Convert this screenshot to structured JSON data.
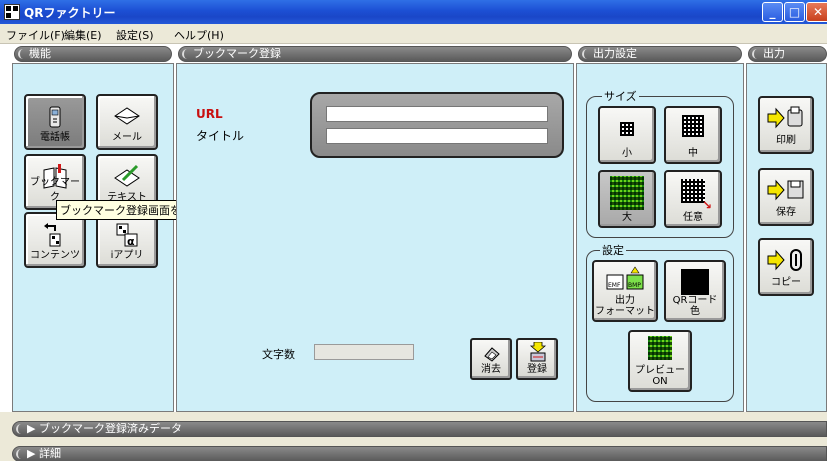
{
  "window": {
    "title": "QRファクトリー",
    "controls": [
      "minimize-icon",
      "maximize-icon",
      "close-icon"
    ]
  },
  "menu": [
    "ファイル(F)",
    "編集(E)",
    "設定(S)",
    "ヘルプ(H)"
  ],
  "panels": {
    "function": {
      "header": "機能",
      "buttons": [
        "電話帳",
        "メール",
        "ブックマーク",
        "テキスト",
        "コンテンツ",
        "iアプリ"
      ],
      "tooltip": "ブックマーク登録画面を表示します"
    },
    "bookmark": {
      "header": "ブックマーク登録",
      "url_label": "URL",
      "title_label": "タイトル",
      "url_value": "",
      "title_value": "",
      "char_count_label": "文字数",
      "char_count_value": "",
      "clear_label": "消去",
      "register_label": "登録"
    },
    "output_settings": {
      "header": "出力設定",
      "size_group": "サイズ",
      "sizes": [
        "小",
        "中",
        "大",
        "任意"
      ],
      "selected_size": "大",
      "settings_group": "設定",
      "format_label": "出力\nフォーマット",
      "format_icons": [
        "EMF",
        "BMP"
      ],
      "qr_color_label": "QRコード\n色",
      "preview_label": "プレビュー\nON"
    },
    "output": {
      "header": "出力",
      "buttons": [
        "印刷",
        "保存",
        "コピー"
      ]
    }
  },
  "bottom": {
    "registered_data": "▶ ブックマーク登録済みデータ",
    "details": "▶ 詳細"
  },
  "colors": {
    "panel_bg": "#cfeff8",
    "titlebar": "#1c4fd4",
    "accent_red": "#c81010",
    "arrow_yellow": "#f5e600"
  }
}
